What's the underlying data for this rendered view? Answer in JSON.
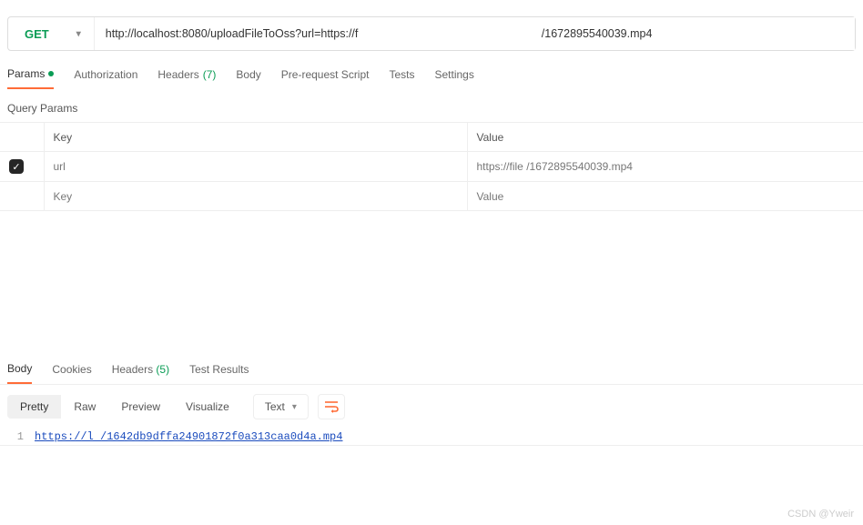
{
  "request": {
    "method": "GET",
    "url": "http://localhost:8080/uploadFileToOss?url=https://f                                                          /1672895540039.mp4"
  },
  "request_tabs": {
    "params": "Params",
    "authorization": "Authorization",
    "headers": "Headers",
    "headers_count": "(7)",
    "body": "Body",
    "prerequest": "Pre-request Script",
    "tests": "Tests",
    "settings": "Settings"
  },
  "section": {
    "query_params": "Query Params"
  },
  "params_table": {
    "header_key": "Key",
    "header_value": "Value",
    "rows": [
      {
        "checked": true,
        "key": "url",
        "value": "https://file                                                             /1672895540039.mp4"
      }
    ],
    "placeholder_key": "Key",
    "placeholder_value": "Value"
  },
  "response_tabs": {
    "body": "Body",
    "cookies": "Cookies",
    "headers": "Headers",
    "headers_count": "(5)",
    "test_results": "Test Results"
  },
  "view": {
    "pretty": "Pretty",
    "raw": "Raw",
    "preview": "Preview",
    "visualize": "Visualize",
    "type": "Text"
  },
  "response_body": {
    "line_no": "1",
    "url_text": "https://l                                                                   /1642db9dffa24901872f0a313caa0d4a.mp4"
  },
  "watermark": "CSDN @Yweir"
}
